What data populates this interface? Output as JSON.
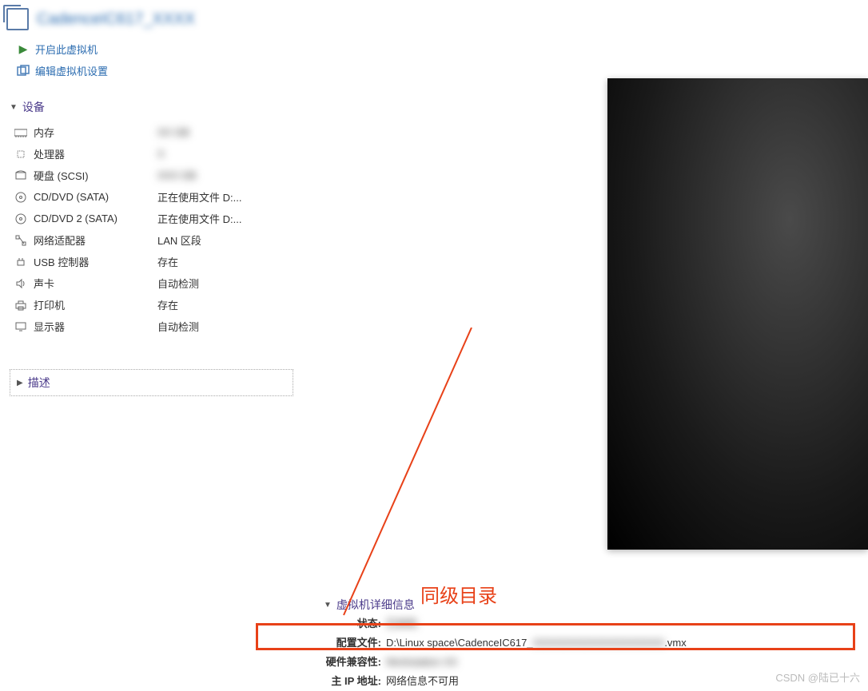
{
  "header": {
    "title": "CadenceIC617_XXXX"
  },
  "actions": {
    "start": "开启此虚拟机",
    "edit": "编辑虚拟机设置"
  },
  "devices": {
    "title": "设备",
    "items": [
      {
        "icon": "memory-icon",
        "name": "内存",
        "value": "XX GB",
        "blur": true
      },
      {
        "icon": "cpu-icon",
        "name": "处理器",
        "value": "X",
        "blur": true
      },
      {
        "icon": "disk-icon",
        "name": "硬盘 (SCSI)",
        "value": "XXX GB",
        "blur": true
      },
      {
        "icon": "cd-icon",
        "name": "CD/DVD (SATA)",
        "value": "正在使用文件 D:...",
        "blur": false
      },
      {
        "icon": "cd-icon",
        "name": "CD/DVD 2 (SATA)",
        "value": "正在使用文件 D:...",
        "blur": false
      },
      {
        "icon": "network-icon",
        "name": "网络适配器",
        "value": "LAN 区段",
        "blur": false
      },
      {
        "icon": "usb-icon",
        "name": "USB 控制器",
        "value": "存在",
        "blur": false
      },
      {
        "icon": "sound-icon",
        "name": "声卡",
        "value": "自动检测",
        "blur": false
      },
      {
        "icon": "printer-icon",
        "name": "打印机",
        "value": "存在",
        "blur": false
      },
      {
        "icon": "display-icon",
        "name": "显示器",
        "value": "自动检测",
        "blur": false
      }
    ]
  },
  "desc": {
    "title": "描述"
  },
  "details": {
    "title": "虚拟机详细信息",
    "rows": [
      {
        "label": "状态:",
        "value": "已关机",
        "blur": true
      },
      {
        "label": "配置文件:",
        "value": "D:\\Linux space\\CadenceIC617_XXXXXXXXXXXXXX_XXX.vmx",
        "blur": false,
        "partblur": true
      },
      {
        "label": "硬件兼容性:",
        "value": "Workstation XX",
        "blur": true
      },
      {
        "label": "主 IP 地址:",
        "value": "网络信息不可用",
        "blur": false
      }
    ]
  },
  "annotation": {
    "text": "同级目录"
  },
  "watermark": "CSDN @陆已十六"
}
